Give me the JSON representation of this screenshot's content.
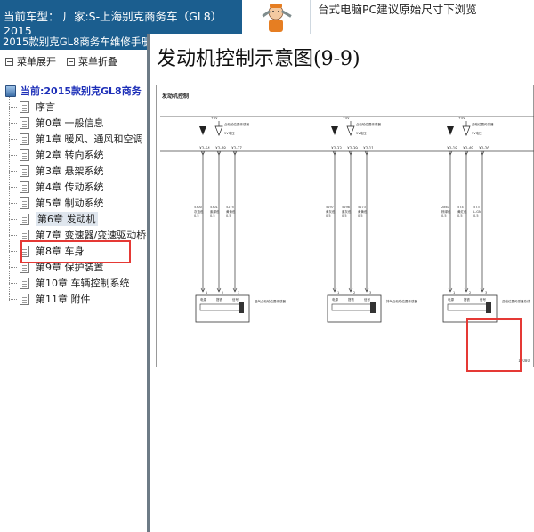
{
  "header": {
    "car_model": "当前车型： 厂家:S-上海别克商务车（GL8）2015",
    "notice": "台式电脑PC建议原始尺寸下浏览"
  },
  "sidebar": {
    "manual_title": "2015款别克GL8商务车维修手册",
    "expand_label": "菜单展开",
    "collapse_label": "菜单折叠",
    "root_label": "当前:2015款别克GL8商务",
    "items": [
      {
        "label": "序言"
      },
      {
        "label": "第0章 一般信息"
      },
      {
        "label": "第1章 暖风、通风和空调"
      },
      {
        "label": "第2章 转向系统"
      },
      {
        "label": "第3章 悬架系统"
      },
      {
        "label": "第4章 传动系统"
      },
      {
        "label": "第5章 制动系统"
      },
      {
        "label": "第6章 发动机"
      },
      {
        "label": "第7章 变速器/变速驱动桥"
      },
      {
        "label": "第8章 车身"
      },
      {
        "label": "第9章 保护装置"
      },
      {
        "label": "第10章 车辆控制系统"
      },
      {
        "label": "第11章 附件"
      }
    ],
    "selected_index": 7
  },
  "content": {
    "title": "发动机控制示意图(9-9)",
    "diagram": {
      "heading": "发动机控制",
      "image_id": "10080",
      "supply": "+5V",
      "circuits": [
        {
          "signal_label": "凸轮轴位置传感器",
          "supply_label": "5V电压",
          "pins": [
            "X2-54",
            "X2-48",
            "X2-27"
          ],
          "wires": [
            {
              "num": "5300",
              "color": "灰蓝色",
              "size": "0.5"
            },
            {
              "num": "5301",
              "color": "紫绿色",
              "size": "0.5"
            },
            {
              "num": "5275",
              "color": "黄黄色",
              "size": "0.5"
            }
          ],
          "terminals": [
            "1",
            "2",
            "3"
          ],
          "sensor_pins": [
            "电源",
            "搭铁",
            "信号"
          ],
          "sensor_name": "进气凸轮轴位置传感器"
        },
        {
          "signal_label": "凸轮轴位置传感器",
          "supply_label": "5V电压",
          "pins": [
            "X2-33",
            "X2-39",
            "X2-11"
          ],
          "wires": [
            {
              "num": "5297",
              "color": "黄灰色",
              "size": "0.5"
            },
            {
              "num": "5298",
              "color": "紫灰色",
              "size": "0.5"
            },
            {
              "num": "5273",
              "color": "黄黄色",
              "size": "0.5"
            }
          ],
          "terminals": [
            "1",
            "2",
            "3"
          ],
          "sensor_pins": [
            "电源",
            "搭铁",
            "信号"
          ],
          "sensor_name": "排气凸轮轴位置传感器"
        },
        {
          "signal_label": "曲轴位置传感器",
          "supply_label": "5V电压",
          "pins": [
            "X2-18",
            "X2-49",
            "X2-26"
          ],
          "wires": [
            {
              "num": "2867",
              "color": "棕绿色",
              "size": "0.5"
            },
            {
              "num": "574",
              "color": "黄红色",
              "size": "0.5"
            },
            {
              "num": "573",
              "color": "L-GN",
              "size": "0.5"
            }
          ],
          "terminals": [
            "1",
            "2",
            "3"
          ],
          "sensor_pins": [
            "电源",
            "搭铁",
            "信号"
          ],
          "sensor_name": "曲轴位置传感器总成"
        }
      ]
    }
  }
}
